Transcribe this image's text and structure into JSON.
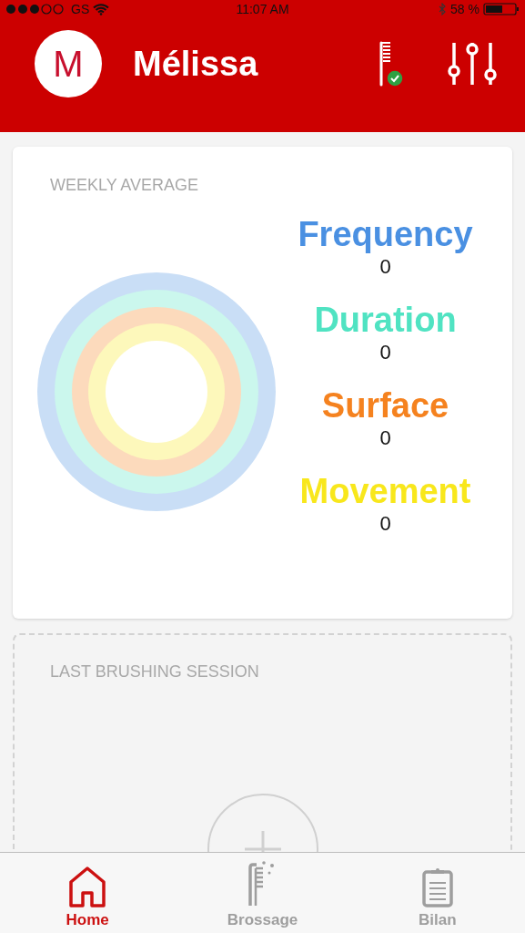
{
  "status_bar": {
    "carrier": "GS",
    "time": "11:07 AM",
    "battery": "58 %"
  },
  "header": {
    "avatar_initial": "M",
    "name": "Mélissa",
    "toothbrush_connected": true
  },
  "weekly_average": {
    "title": "WEEKLY AVERAGE",
    "metrics": [
      {
        "label": "Frequency",
        "value": "0",
        "color": "#4a90e2"
      },
      {
        "label": "Duration",
        "value": "0",
        "color": "#50e3c2"
      },
      {
        "label": "Surface",
        "value": "0",
        "color": "#f5821f"
      },
      {
        "label": "Movement",
        "value": "0",
        "color": "#f8e71c"
      }
    ]
  },
  "last_session": {
    "title": "LAST BRUSHING SESSION"
  },
  "tabs": [
    {
      "label": "Home",
      "selected": true
    },
    {
      "label": "Brossage",
      "selected": false
    },
    {
      "label": "Bilan",
      "selected": false
    }
  ]
}
